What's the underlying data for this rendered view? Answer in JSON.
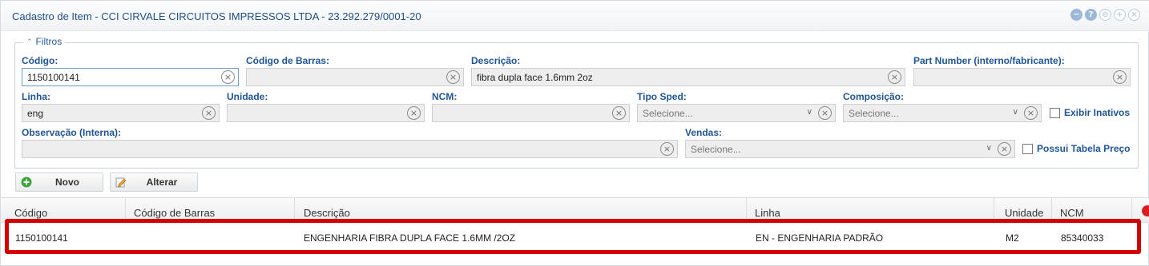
{
  "window": {
    "title": "Cadastro de Item - CCI CIRVALE CIRCUITOS IMPRESSOS LTDA - 23.292.279/0001-20"
  },
  "titlebar_icons": [
    "minimize-icon",
    "help-icon",
    "info-icon",
    "maximize-icon",
    "close-icon"
  ],
  "titlebar_glyphs": {
    "minimize": "−",
    "help": "?",
    "info": "⊝",
    "maximize": "+",
    "close": "×"
  },
  "filters": {
    "legend": "Filtros",
    "codigo": {
      "label": "Código:",
      "value": "1150100141"
    },
    "codigo_barras": {
      "label": "Código de Barras:",
      "value": ""
    },
    "descricao": {
      "label": "Descrição:",
      "value": "fibra dupla face 1.6mm 2oz"
    },
    "part_number": {
      "label": "Part Number (interno/fabricante):",
      "value": ""
    },
    "linha": {
      "label": "Linha:",
      "value": "eng"
    },
    "unidade": {
      "label": "Unidade:",
      "value": ""
    },
    "ncm": {
      "label": "NCM:",
      "value": ""
    },
    "tipo_sped": {
      "label": "Tipo Sped:",
      "placeholder": "Selecione..."
    },
    "composicao": {
      "label": "Composição:",
      "placeholder": "Selecione..."
    },
    "exibir_inativos": {
      "label": "Exibir Inativos",
      "checked": false
    },
    "observacao": {
      "label": "Observação (Interna):",
      "value": ""
    },
    "vendas": {
      "label": "Vendas:",
      "placeholder": "Selecione..."
    },
    "possui_tabela_preco": {
      "label": "Possui Tabela Preço",
      "checked": false
    },
    "clear_glyph": "×",
    "chevron_glyph": "∨"
  },
  "toolbar": {
    "novo_label": "Novo",
    "alterar_label": "Alterar"
  },
  "grid": {
    "columns": [
      "Código",
      "Código de Barras",
      "Descrição",
      "Linha",
      "Unidade",
      "NCM"
    ],
    "rows": [
      {
        "codigo": "1150100141",
        "codigo_barras": "",
        "descricao": "ENGENHARIA FIBRA DUPLA FACE 1.6MM /2OZ",
        "linha": "EN - ENGENHARIA PADRÃO",
        "unidade": "M2",
        "ncm": "85340033"
      }
    ]
  },
  "colors": {
    "title": "#1f4e86",
    "label": "#1f5597",
    "highlight": "#d40000",
    "add_icon": "#3aa63a"
  }
}
